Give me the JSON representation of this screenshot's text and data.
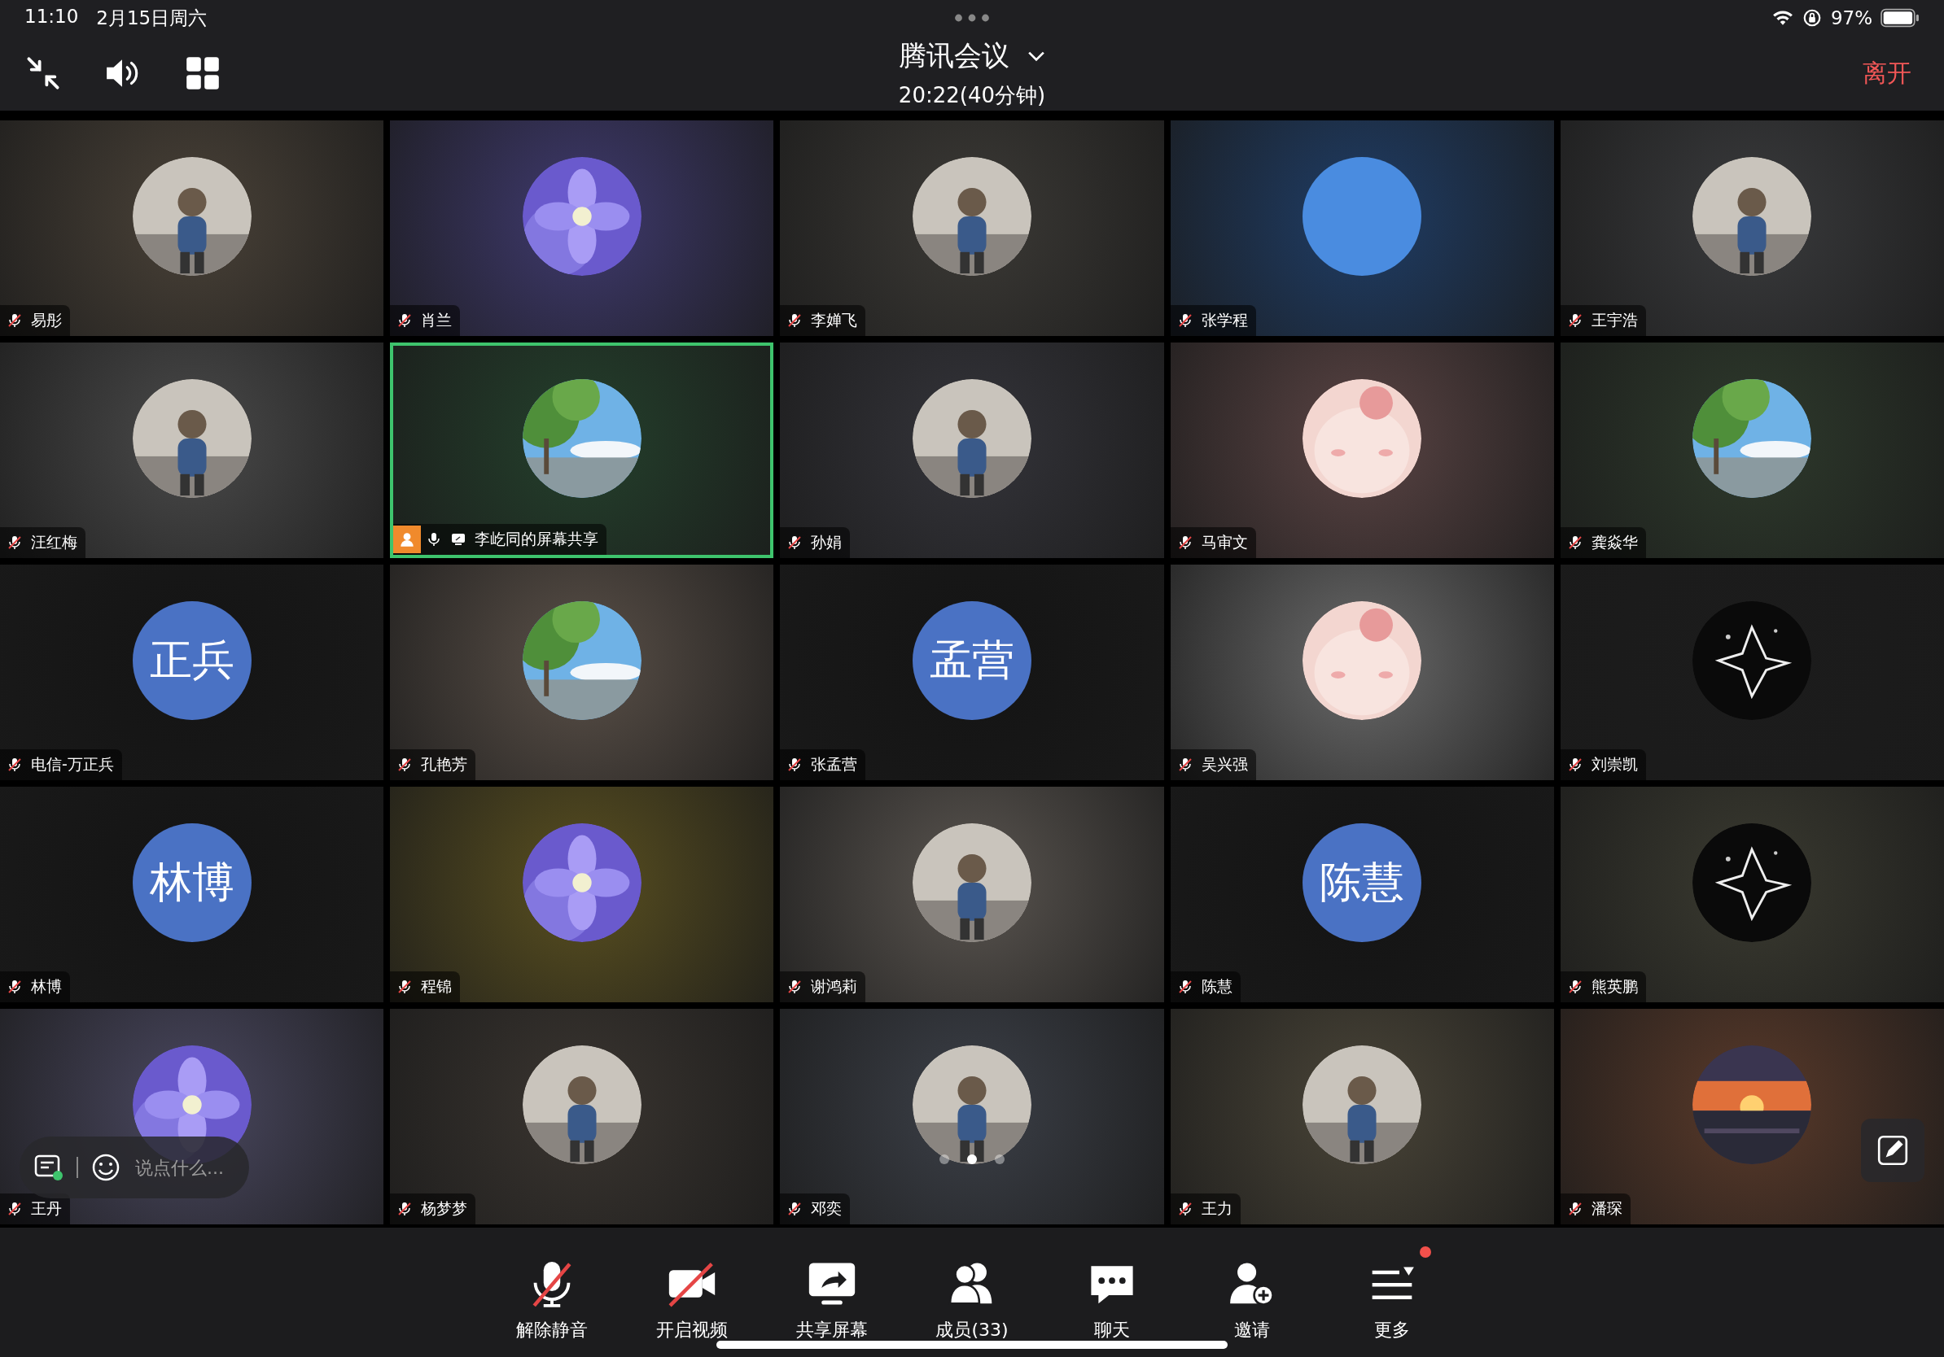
{
  "status_bar": {
    "time": "11:10",
    "date": "2月15日周六",
    "battery": "97%"
  },
  "header": {
    "title": "腾讯会议",
    "subtitle": "20:22(40分钟)",
    "leave": "离开"
  },
  "tiles": [
    {
      "name": "易彤",
      "kind": "picture",
      "muted": true,
      "sharing": false,
      "selected": false
    },
    {
      "name": "肖兰",
      "kind": "picture",
      "muted": true,
      "sharing": false,
      "selected": false
    },
    {
      "name": "李婵飞",
      "kind": "picture",
      "muted": true,
      "sharing": false,
      "selected": false
    },
    {
      "name": "张学程",
      "kind": "plain",
      "muted": true,
      "sharing": false,
      "selected": false
    },
    {
      "name": "王宇浩",
      "kind": "picture",
      "muted": true,
      "sharing": false,
      "selected": false
    },
    {
      "name": "汪红梅",
      "kind": "picture",
      "muted": true,
      "sharing": false,
      "selected": false
    },
    {
      "name": "李屹同的屏幕共享",
      "kind": "picture",
      "muted": false,
      "sharing": true,
      "selected": true
    },
    {
      "name": "孙娟",
      "kind": "picture",
      "muted": true,
      "sharing": false,
      "selected": false
    },
    {
      "name": "马审文",
      "kind": "picture",
      "muted": true,
      "sharing": false,
      "selected": false
    },
    {
      "name": "龚焱华",
      "kind": "picture",
      "muted": true,
      "sharing": false,
      "selected": false
    },
    {
      "name": "电信-万正兵",
      "kind": "initials",
      "initials": "正兵",
      "muted": true,
      "sharing": false,
      "selected": false
    },
    {
      "name": "孔艳芳",
      "kind": "picture",
      "muted": true,
      "sharing": false,
      "selected": false
    },
    {
      "name": "张孟营",
      "kind": "initials",
      "initials": "孟营",
      "muted": true,
      "sharing": false,
      "selected": false
    },
    {
      "name": "吴兴强",
      "kind": "picture",
      "muted": true,
      "sharing": false,
      "selected": false
    },
    {
      "name": "刘崇凯",
      "kind": "picture",
      "muted": true,
      "sharing": false,
      "selected": false
    },
    {
      "name": "林博",
      "kind": "initials",
      "initials": "林博",
      "muted": true,
      "sharing": false,
      "selected": false
    },
    {
      "name": "程锦",
      "kind": "picture",
      "muted": true,
      "sharing": false,
      "selected": false
    },
    {
      "name": "谢鸿莉",
      "kind": "picture",
      "muted": true,
      "sharing": false,
      "selected": false
    },
    {
      "name": "陈慧",
      "kind": "initials",
      "initials": "陈慧",
      "muted": true,
      "sharing": false,
      "selected": false
    },
    {
      "name": "熊英鹏",
      "kind": "picture",
      "muted": true,
      "sharing": false,
      "selected": false
    },
    {
      "name": "王丹",
      "kind": "picture",
      "muted": true,
      "sharing": false,
      "selected": false
    },
    {
      "name": "杨梦梦",
      "kind": "picture",
      "muted": true,
      "sharing": false,
      "selected": false
    },
    {
      "name": "邓奕",
      "kind": "picture",
      "muted": true,
      "sharing": false,
      "selected": false
    },
    {
      "name": "王力",
      "kind": "picture",
      "muted": true,
      "sharing": false,
      "selected": false
    },
    {
      "name": "潘琛",
      "kind": "picture",
      "muted": true,
      "sharing": false,
      "selected": false
    }
  ],
  "pager": [
    {
      "selected": false
    },
    {
      "selected": true
    },
    {
      "selected": false
    }
  ],
  "chat_input": {
    "placeholder": "说点什么..."
  },
  "toolbar": [
    {
      "kind": "unmute",
      "label": "解除静音"
    },
    {
      "kind": "video",
      "label": "开启视频"
    },
    {
      "kind": "share",
      "label": "共享屏幕"
    },
    {
      "kind": "members",
      "label": "成员(33)"
    },
    {
      "kind": "chat",
      "label": "聊天"
    },
    {
      "kind": "invite",
      "label": "邀请"
    },
    {
      "kind": "more",
      "label": "更多",
      "badge": true
    }
  ]
}
